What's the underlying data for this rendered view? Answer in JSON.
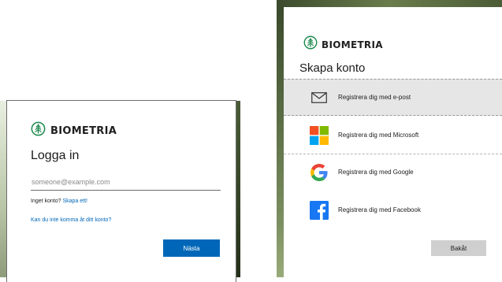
{
  "brand": {
    "name": "BIOMETRIA",
    "color": "#1e8b4f"
  },
  "login": {
    "title": "Logga in",
    "email_placeholder": "someone@example.com",
    "no_account_text": "Inget konto?",
    "create_link": "Skapa ett!",
    "cant_access_link": "Kan du inte komma åt ditt konto?",
    "next_button": "Nästa",
    "accent": "#0067b8"
  },
  "register": {
    "title": "Skapa konto",
    "options": [
      {
        "label": "Registrera dig med e-post",
        "icon": "envelope-icon"
      },
      {
        "label": "Registrera dig med Microsoft",
        "icon": "microsoft-icon"
      },
      {
        "label": "Registrera dig med Google",
        "icon": "google-icon"
      },
      {
        "label": "Registrera dig med Facebook",
        "icon": "facebook-icon"
      }
    ],
    "back_button": "Bakåt"
  }
}
